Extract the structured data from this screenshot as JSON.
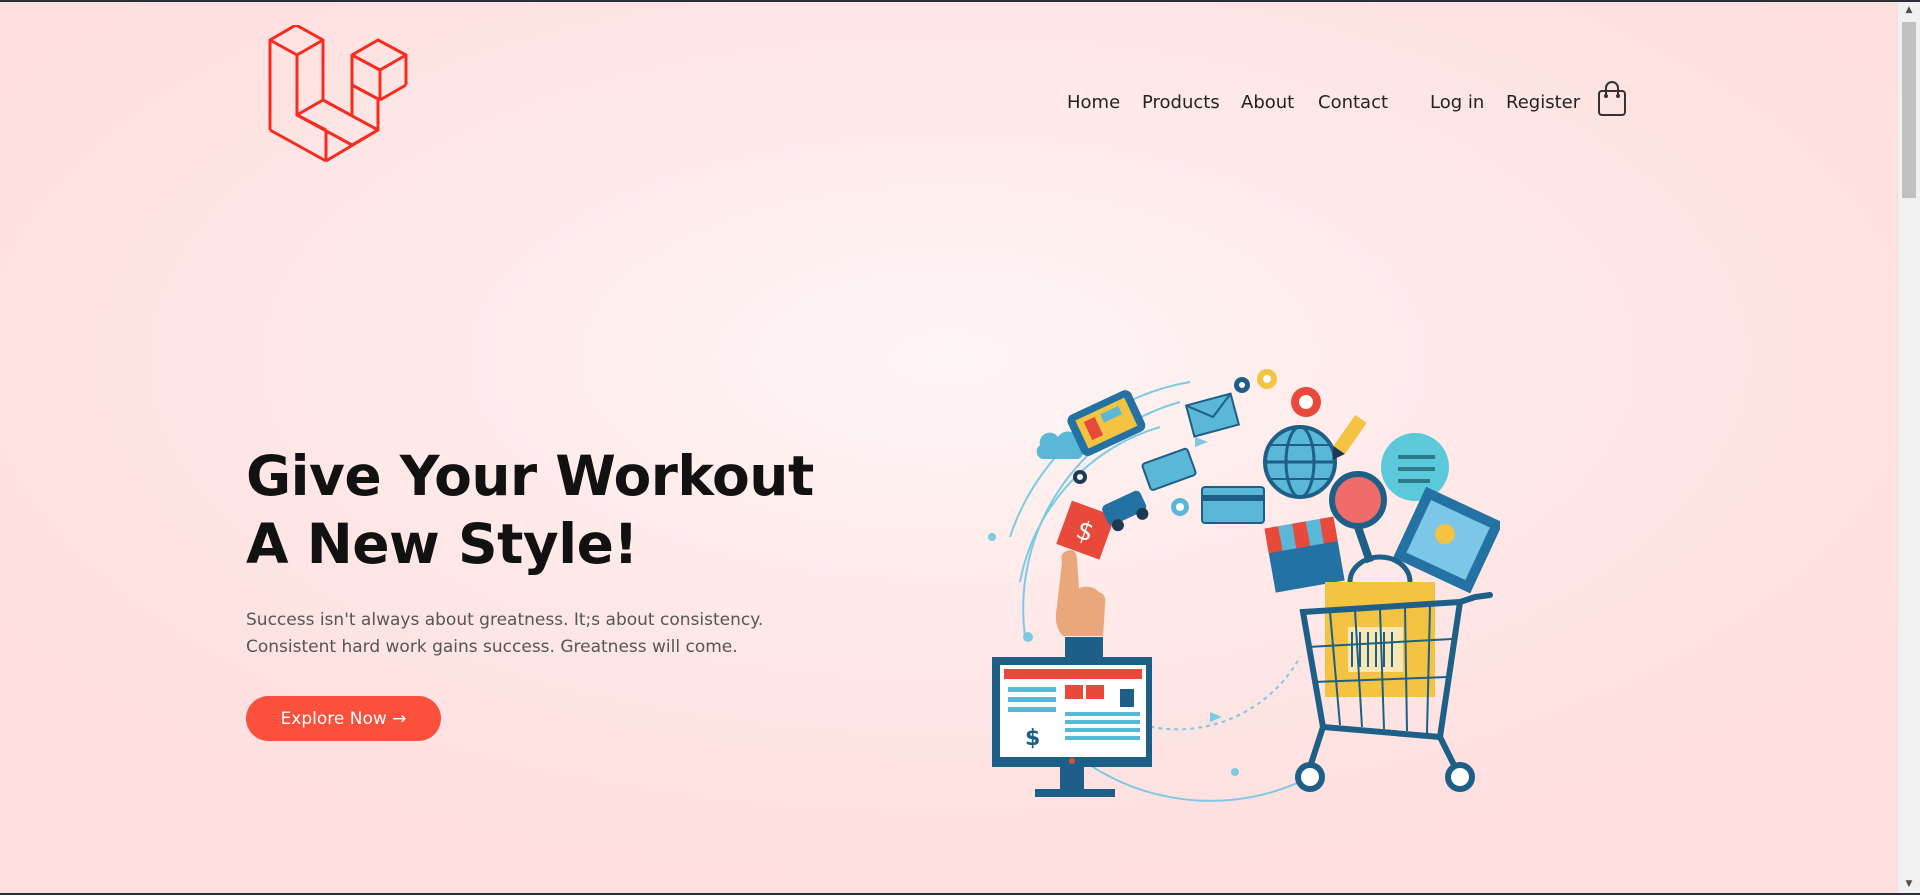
{
  "brand": {
    "logo_icon": "laravel-logo-icon",
    "color": "#f72c1f"
  },
  "nav": {
    "items": [
      {
        "label": "Home"
      },
      {
        "label": "Products"
      },
      {
        "label": "About"
      },
      {
        "label": "Contact"
      }
    ],
    "login_label": "Log in",
    "register_label": "Register",
    "cart_icon": "shopping-bag-icon"
  },
  "hero": {
    "title_line1": "Give Your Workout",
    "title_line2": "A New Style!",
    "description": "Success isn't always about greatness. It;s about consistency. Consistent hard work gains success. Greatness will come.",
    "cta_label": "Explore Now →",
    "illustration_icon": "online-shopping-illustration",
    "accent_color": "#fb503b"
  },
  "colors": {
    "background": "#ffe4e4",
    "text": "#111111",
    "muted_text": "#555555"
  }
}
